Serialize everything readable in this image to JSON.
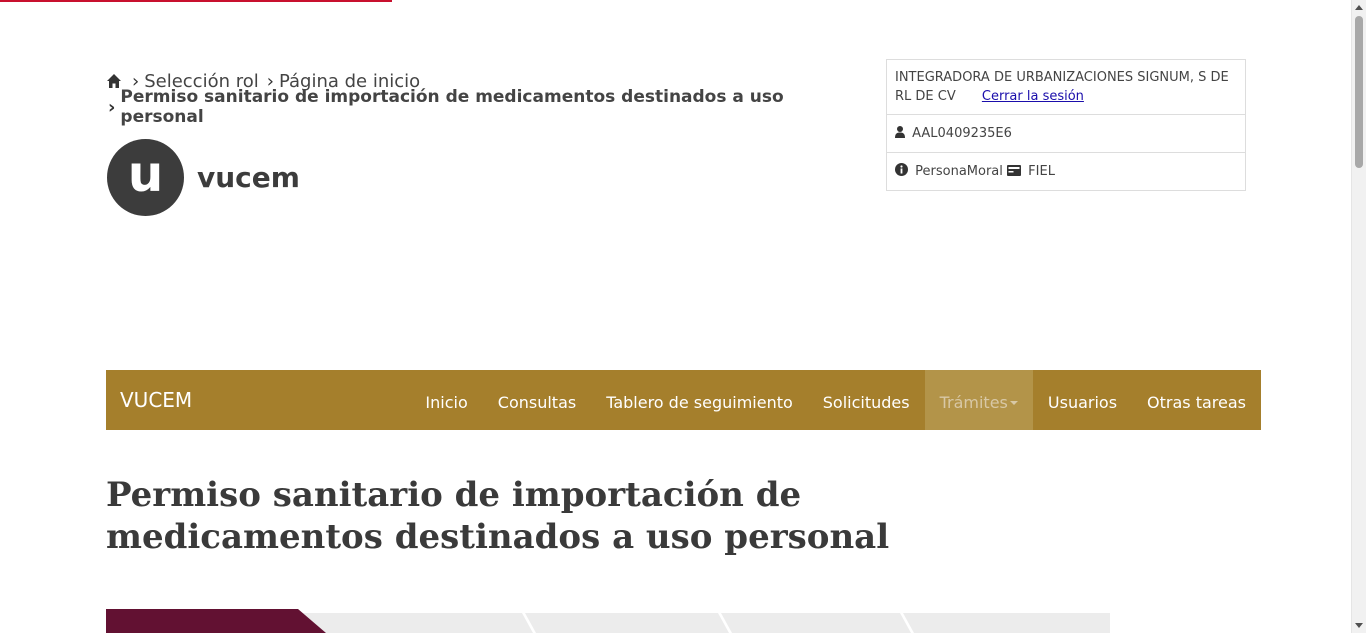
{
  "breadcrumb": {
    "home_icon": "home-icon",
    "items": [
      "Selección rol",
      "Página de inicio"
    ],
    "current": "Permiso sanitario de importación de medicamentos destinados a uso personal"
  },
  "logo": {
    "letter": "u",
    "text": "vucem"
  },
  "user": {
    "company": "INTEGRADORA DE URBANIZACIONES SIGNUM, S DE RL DE CV",
    "logout": "Cerrar la sesión",
    "rfc": "AAL0409235E6",
    "person_type": "PersonaMoral",
    "auth": "FIEL",
    "icons": [
      "user-icon",
      "info-icon",
      "card-icon"
    ]
  },
  "navbar": {
    "brand": "VUCEM",
    "items": [
      "Inicio",
      "Consultas",
      "Tablero de seguimiento",
      "Solicitudes",
      "Trámites",
      "Usuarios",
      "Otras tareas"
    ],
    "active": "Trámites"
  },
  "page": {
    "title": "Permiso sanitario de importación de medicamentos destinados a uso personal"
  },
  "colors": {
    "navbar": "#a57f2c",
    "active_step": "#621132",
    "top_line": "#c8102e",
    "link": "#1a0dab"
  }
}
